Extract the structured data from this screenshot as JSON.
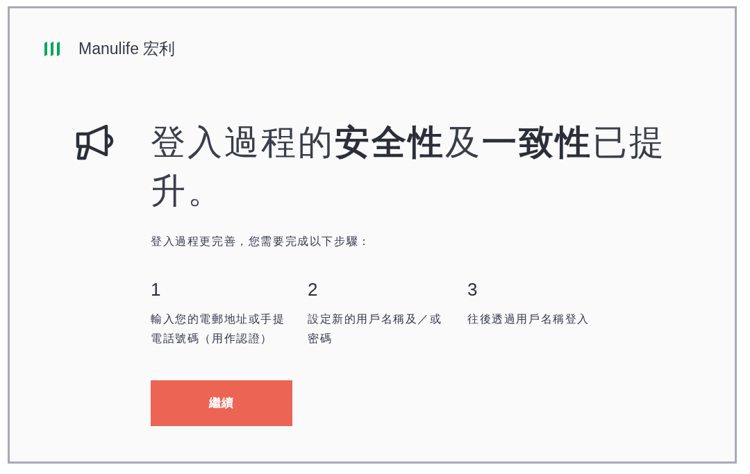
{
  "header": {
    "logo_text": "Manulife 宏利"
  },
  "announcement": {
    "headline": "登入過程的**安全性**及**一致性**已提升。",
    "intro": "登入過程更完善，您需要完成以下步驟："
  },
  "steps": [
    {
      "number": "1",
      "text": "輸入您的電郵地址或手提電話號碼（用作認證）"
    },
    {
      "number": "2",
      "text": "設定新的用戶名稱及／或密碼"
    },
    {
      "number": "3",
      "text": "往後透過用戶名稱登入"
    }
  ],
  "continue_button": {
    "label": "繼續"
  }
}
